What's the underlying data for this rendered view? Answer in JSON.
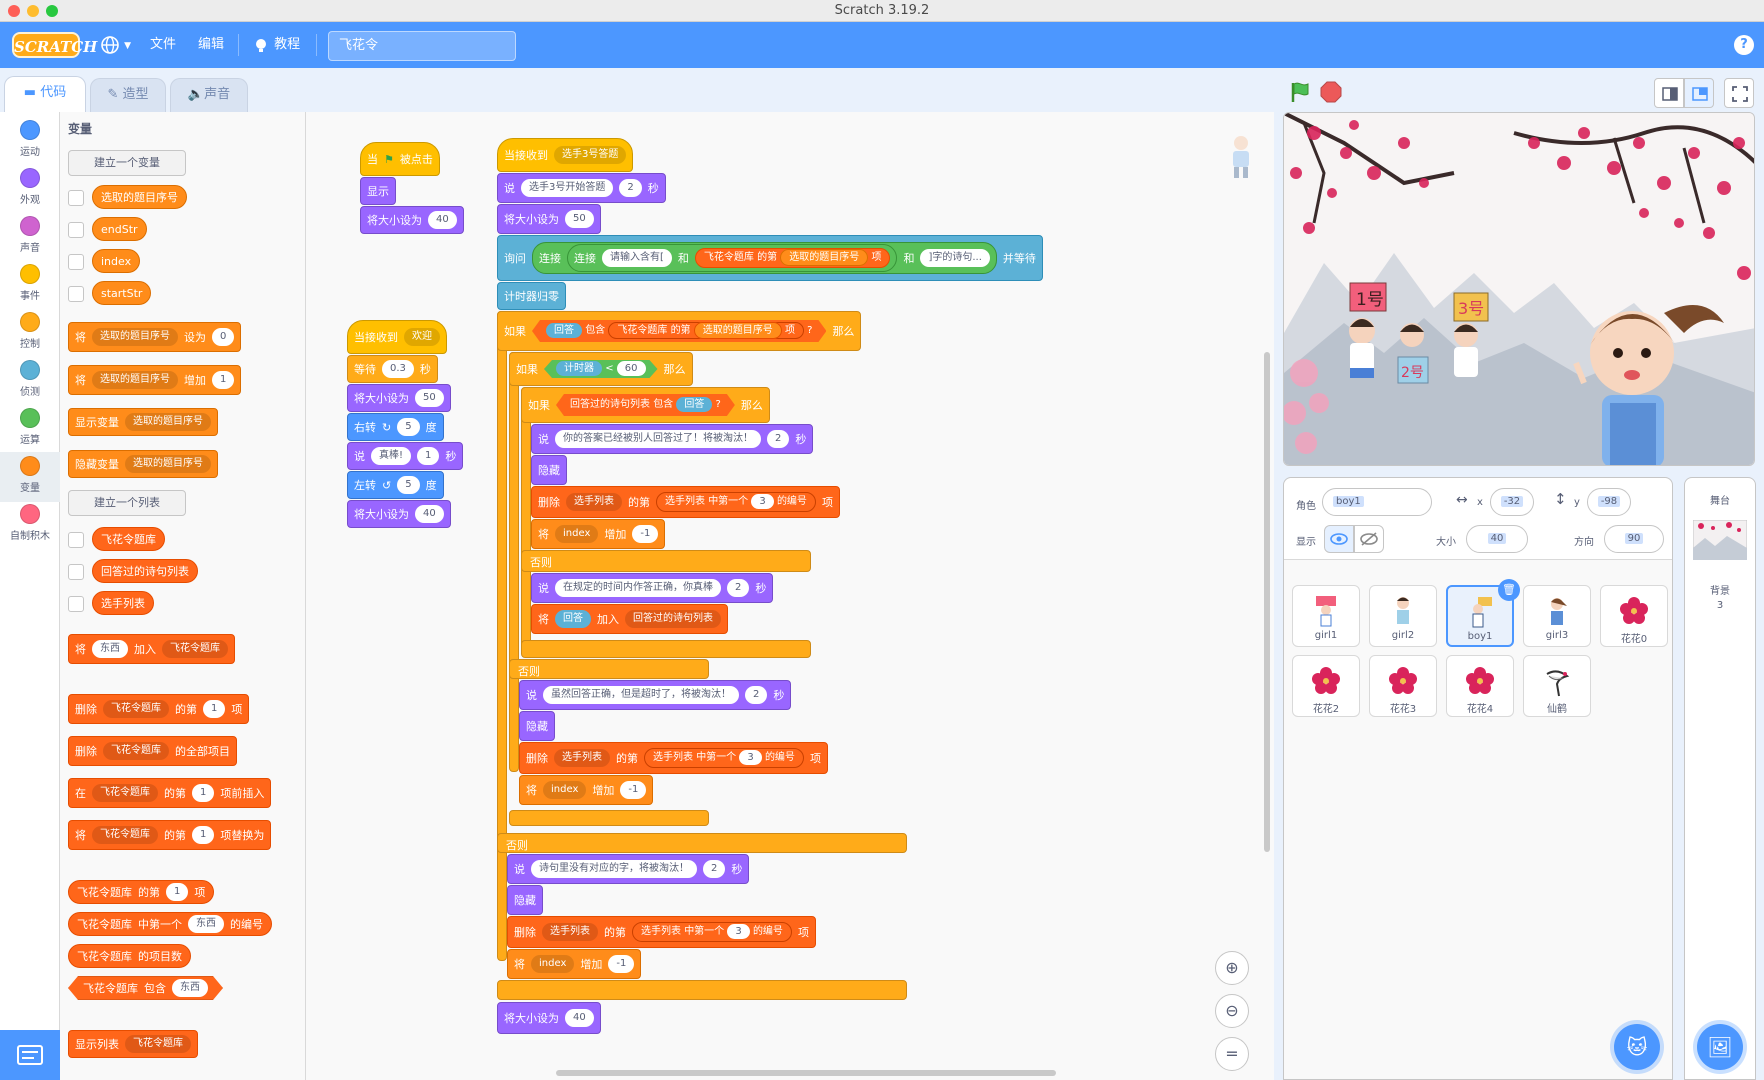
{
  "window": {
    "title": "Scratch 3.19.2"
  },
  "menu": {
    "file": "文件",
    "edit": "编辑",
    "tutorials": "教程",
    "project_title": "飞花令",
    "logo": "SCRATCH",
    "help": "?"
  },
  "tabs": {
    "code": "代码",
    "costumes": "造型",
    "sounds": "声音"
  },
  "categories": [
    {
      "label": "运动",
      "color": "#4c97ff"
    },
    {
      "label": "外观",
      "color": "#9966ff"
    },
    {
      "label": "声音",
      "color": "#cf63cf"
    },
    {
      "label": "事件",
      "color": "#ffbf00"
    },
    {
      "label": "控制",
      "color": "#ffab19"
    },
    {
      "label": "侦测",
      "color": "#5cb1d6"
    },
    {
      "label": "运算",
      "color": "#59c059"
    },
    {
      "label": "变量",
      "color": "#ff8c1a"
    },
    {
      "label": "自制积木",
      "color": "#ff6680"
    }
  ],
  "palette": {
    "section": "变量",
    "make_variable": "建立一个变量",
    "vars": [
      "选取的题目序号",
      "endStr",
      "index",
      "startStr"
    ],
    "set": "将",
    "set_var": "选取的题目序号",
    "set_to": "设为",
    "set_val": "0",
    "change": "将",
    "change_var": "选取的题目序号",
    "change_by": "增加",
    "change_val": "1",
    "show_var": "显示变量",
    "show_var_name": "选取的题目序号",
    "hide_var": "隐藏变量",
    "hide_var_name": "选取的题目序号",
    "make_list": "建立一个列表",
    "lists": [
      "飞花令题库",
      "回答过的诗句列表",
      "选手列表"
    ],
    "add_thing": "东西",
    "add_to": "加入",
    "add_list": "飞花令题库",
    "delete": "删除",
    "delete_list": "飞花令题库",
    "of_item": "的第",
    "item_n": "1",
    "item": "项",
    "delete_all": "的全部项目",
    "insert_at": "在",
    "insert_before": "项前插入",
    "replace": "项替换为",
    "item_of": "飞花令题库",
    "item_of_lbl": "的第",
    "item_of_n": "1",
    "item_of_item": "项",
    "index_of": "中第一个",
    "index_of_thing": "东西",
    "index_of_lbl": "的编号",
    "length": "的项目数",
    "contains": "包含",
    "contains_thing": "东西",
    "show_list": "显示列表"
  },
  "script_a": {
    "hat": "当",
    "hat_flag": "被点击",
    "show": "显示",
    "size": "将大小设为",
    "size_val": "40"
  },
  "script_b": {
    "hat": "当接收到",
    "msg": "欢迎",
    "wait": "等待",
    "wait_val": "0.3",
    "wait_unit": "秒",
    "turn_r": "右转",
    "deg_val": "5",
    "deg": "度",
    "say": "说",
    "say_text": "真棒!",
    "say_secs": "1",
    "secs": "秒",
    "turn_l": "左转",
    "deg_val2": "5",
    "size": "将大小设为",
    "size1": "50",
    "size2": "40"
  },
  "script_c": {
    "hat": "当接收到",
    "msg": "选手3号答题",
    "say1": "说",
    "say1_text": "选手3号开始答题",
    "say1_secs": "2",
    "secs": "秒",
    "size": "将大小设为",
    "size_val": "50",
    "ask": "询问",
    "join": "连接",
    "join_text": "请输入含有[",
    "and": "和",
    "list": "飞花令题库",
    "of_item": "的第",
    "var_sel": "选取的题目序号",
    "item": "项",
    "join_end": "]字的诗句...",
    "ask_wait": "并等待",
    "reset_timer": "计时器归零",
    "if": "如果",
    "then": "那么",
    "else": "否则",
    "answer": "回答",
    "contains": "包含",
    "timer": "计时器",
    "lt": "<",
    "timer_val": "60",
    "answered_list": "回答过的诗句列表",
    "say2": "你的答案已经被别人回答过了！将被淘汰！",
    "say2_secs": "2",
    "hide": "隐藏",
    "delete": "删除",
    "players": "选手列表",
    "index_of": "中第一个",
    "num3": "3",
    "index_lbl": "的编号",
    "change": "将",
    "index_var": "index",
    "change_by": "增加",
    "neg1": "-1",
    "say3": "在规定的时间内作答正确，你真棒",
    "say3_secs": "2",
    "add_to": "加入",
    "say4": "虽然回答正确，但是超时了，将被淘汰！",
    "say4_secs": "2",
    "say5": "诗句里没有对应的字，将被淘汰！",
    "say5_secs": "2",
    "size_end": "40"
  },
  "sprite_info": {
    "sprite_label": "角色",
    "sprite_name": "boy1",
    "x_label": "x",
    "x_val": "-32",
    "y_label": "y",
    "y_val": "-98",
    "show_label": "显示",
    "size_label": "大小",
    "size_val": "40",
    "dir_label": "方向",
    "dir_val": "90"
  },
  "sprites": [
    "girl1",
    "girl2",
    "boy1",
    "girl3",
    "花花0",
    "花花2",
    "花花3",
    "花花4",
    "仙鹤"
  ],
  "stage_panel": {
    "title": "舞台",
    "backdrops_label": "背景",
    "backdrops_count": "3"
  },
  "stage_signs": {
    "s1": "1号",
    "s2": "2号",
    "s3": "3号"
  }
}
